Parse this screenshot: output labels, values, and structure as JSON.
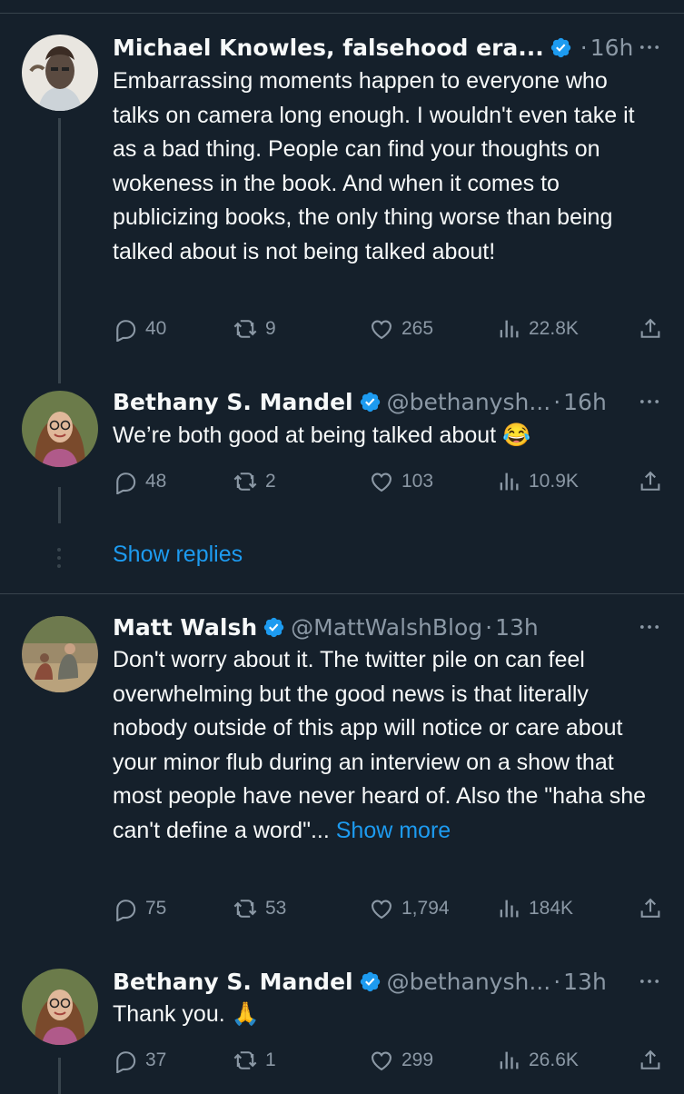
{
  "colors": {
    "background": "#15202b",
    "text": "#f7f9f9",
    "muted": "#8b98a5",
    "accent": "#1d9bf0",
    "border": "#38444d"
  },
  "tweets": [
    {
      "name": "Michael Knowles, falsehood era...",
      "handle": "",
      "time": "16h",
      "text": "Embarrassing moments happen to everyone who talks on camera long enough. I wouldn't even take it as a bad thing. People can find your thoughts on wokeness in the book. And when it comes to publicizing books, the only thing worse than being talked about is not being talked about!",
      "show_more": "",
      "replies": "40",
      "retweets": "9",
      "likes": "265",
      "views": "22.8K"
    },
    {
      "name": "Bethany S. Mandel",
      "handle": "@bethanysh...",
      "time": "16h",
      "text": "We’re both good at being talked about 😂",
      "show_more": "",
      "replies": "48",
      "retweets": "2",
      "likes": "103",
      "views": "10.9K"
    },
    {
      "name": "Matt Walsh",
      "handle": "@MattWalshBlog",
      "time": "13h",
      "text": "Don't worry about it. The twitter pile on can feel overwhelming but the good news is that literally nobody outside of this app will notice or care about your minor flub during an interview on a show that most people have never heard of. Also the \"haha she can't define a word\"...",
      "show_more": "Show more",
      "replies": "75",
      "retweets": "53",
      "likes": "1,794",
      "views": "184K"
    },
    {
      "name": "Bethany S. Mandel",
      "handle": "@bethanysh...",
      "time": "13h",
      "text": "Thank you. 🙏",
      "show_more": "",
      "replies": "37",
      "retweets": "1",
      "likes": "299",
      "views": "26.6K"
    }
  ],
  "show_replies": "Show replies",
  "icons": [
    "verified-badge-icon",
    "more-icon",
    "reply-icon",
    "retweet-icon",
    "like-icon",
    "views-icon",
    "share-icon"
  ]
}
